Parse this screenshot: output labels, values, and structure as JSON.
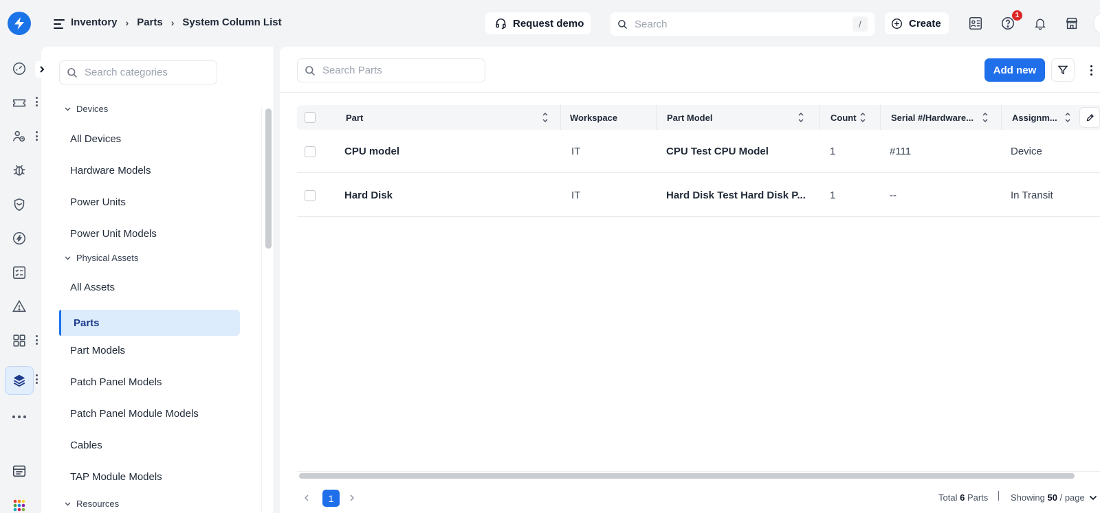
{
  "header": {
    "breadcrumb": [
      "Inventory",
      "Parts",
      "System Column List"
    ],
    "request_demo": "Request demo",
    "search_placeholder": "Search",
    "search_shortcut": "/",
    "create": "Create",
    "help_badge": "1"
  },
  "categories": {
    "search_placeholder": "Search categories",
    "groups": {
      "devices": "Devices",
      "physical_assets": "Physical Assets",
      "resources": "Resources"
    },
    "items": [
      "All Devices",
      "Hardware Models",
      "Power Units",
      "Power Unit Models",
      "All Assets",
      "Parts",
      "Part Models",
      "Patch Panel Models",
      "Patch Panel Module Models",
      "Cables",
      "TAP Module Models"
    ],
    "active_item": "Parts"
  },
  "main": {
    "search_placeholder": "Search Parts",
    "add_new": "Add new",
    "columns": [
      "Part",
      "Workspace",
      "Part Model",
      "Count",
      "Serial #/Hardware...",
      "Assignm..."
    ],
    "rows": [
      [
        "CPU model",
        "IT",
        "CPU Test CPU Model",
        "1",
        "#111",
        "Device"
      ],
      [
        "Hard Disk",
        "IT",
        "Hard Disk Test Hard Disk P...",
        "1",
        "--",
        "In Transit"
      ]
    ],
    "pagination": {
      "current_page": "1",
      "total_label": "Total",
      "total_count": "6",
      "total_unit": "Parts",
      "showing_label": "Showing",
      "per_page": "50",
      "per_page_unit": "/ page"
    }
  },
  "colors": {
    "accent": "#1f6feb",
    "brand": "#1b73e8",
    "active_bg": "#dcecfd",
    "badge": "#dc2626"
  },
  "icons": [
    "logo-bolt-icon",
    "hamburger-icon",
    "headset-icon",
    "search-icon",
    "plus-circle-icon",
    "contact-list-icon",
    "help-icon",
    "bell-icon",
    "store-icon",
    "dashboard-icon",
    "ticket-icon",
    "users-icon",
    "bug-icon",
    "shield-icon",
    "compass-icon",
    "checklist-icon",
    "warning-icon",
    "apps-grid-icon",
    "layers-icon",
    "more-horizontal-icon",
    "window-icon",
    "colorful-grid-icon",
    "filter-icon",
    "pencil-icon",
    "sort-icon",
    "chevron-down-icon"
  ]
}
